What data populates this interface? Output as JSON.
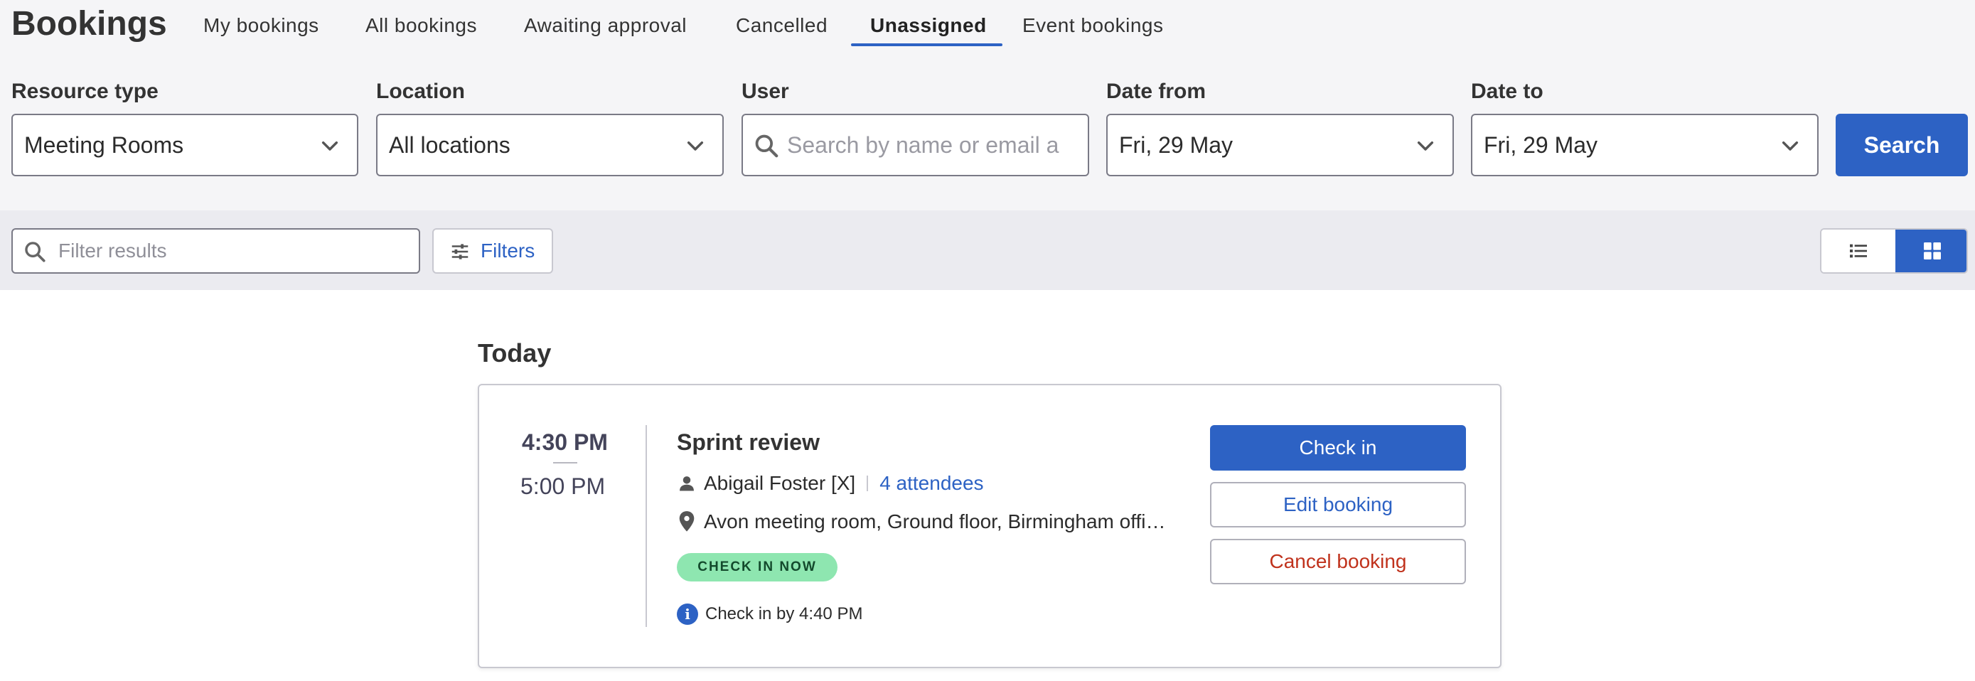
{
  "header": {
    "title": "Bookings",
    "tabs": [
      {
        "label": "My bookings"
      },
      {
        "label": "All bookings"
      },
      {
        "label": "Awaiting approval"
      },
      {
        "label": "Cancelled"
      },
      {
        "label": "Unassigned"
      },
      {
        "label": "Event bookings"
      }
    ],
    "active_tab": "Unassigned"
  },
  "search": {
    "resource_type_label": "Resource type",
    "resource_type_value": "Meeting Rooms",
    "location_label": "Location",
    "location_value": "All locations",
    "user_label": "User",
    "user_placeholder": "Search by name or email a",
    "date_from_label": "Date from",
    "date_from_value": "Fri, 29 May",
    "date_to_label": "Date to",
    "date_to_value": "Fri, 29 May",
    "search_button": "Search"
  },
  "filterbar": {
    "filter_placeholder": "Filter results",
    "filters_button": "Filters",
    "active_view": "grid"
  },
  "results": {
    "section_title": "Today",
    "booking": {
      "start_time": "4:30 PM",
      "end_time": "5:00 PM",
      "title": "Sprint review",
      "organizer": "Abigail Foster [X]",
      "attendees": "4 attendees",
      "location": "Avon meeting room, Ground floor, Birmingham offi…",
      "status_badge": "CHECK IN NOW",
      "check_in_note": "Check in by 4:40 PM",
      "check_in_button": "Check in",
      "edit_button": "Edit booking",
      "cancel_button": "Cancel booking"
    }
  },
  "colors": {
    "accent": "#2d62c4",
    "badge_bg": "#8ee6b0",
    "danger": "#c0321c",
    "header_bg": "#f5f5f7",
    "filterbar_bg": "#ebebf0"
  }
}
